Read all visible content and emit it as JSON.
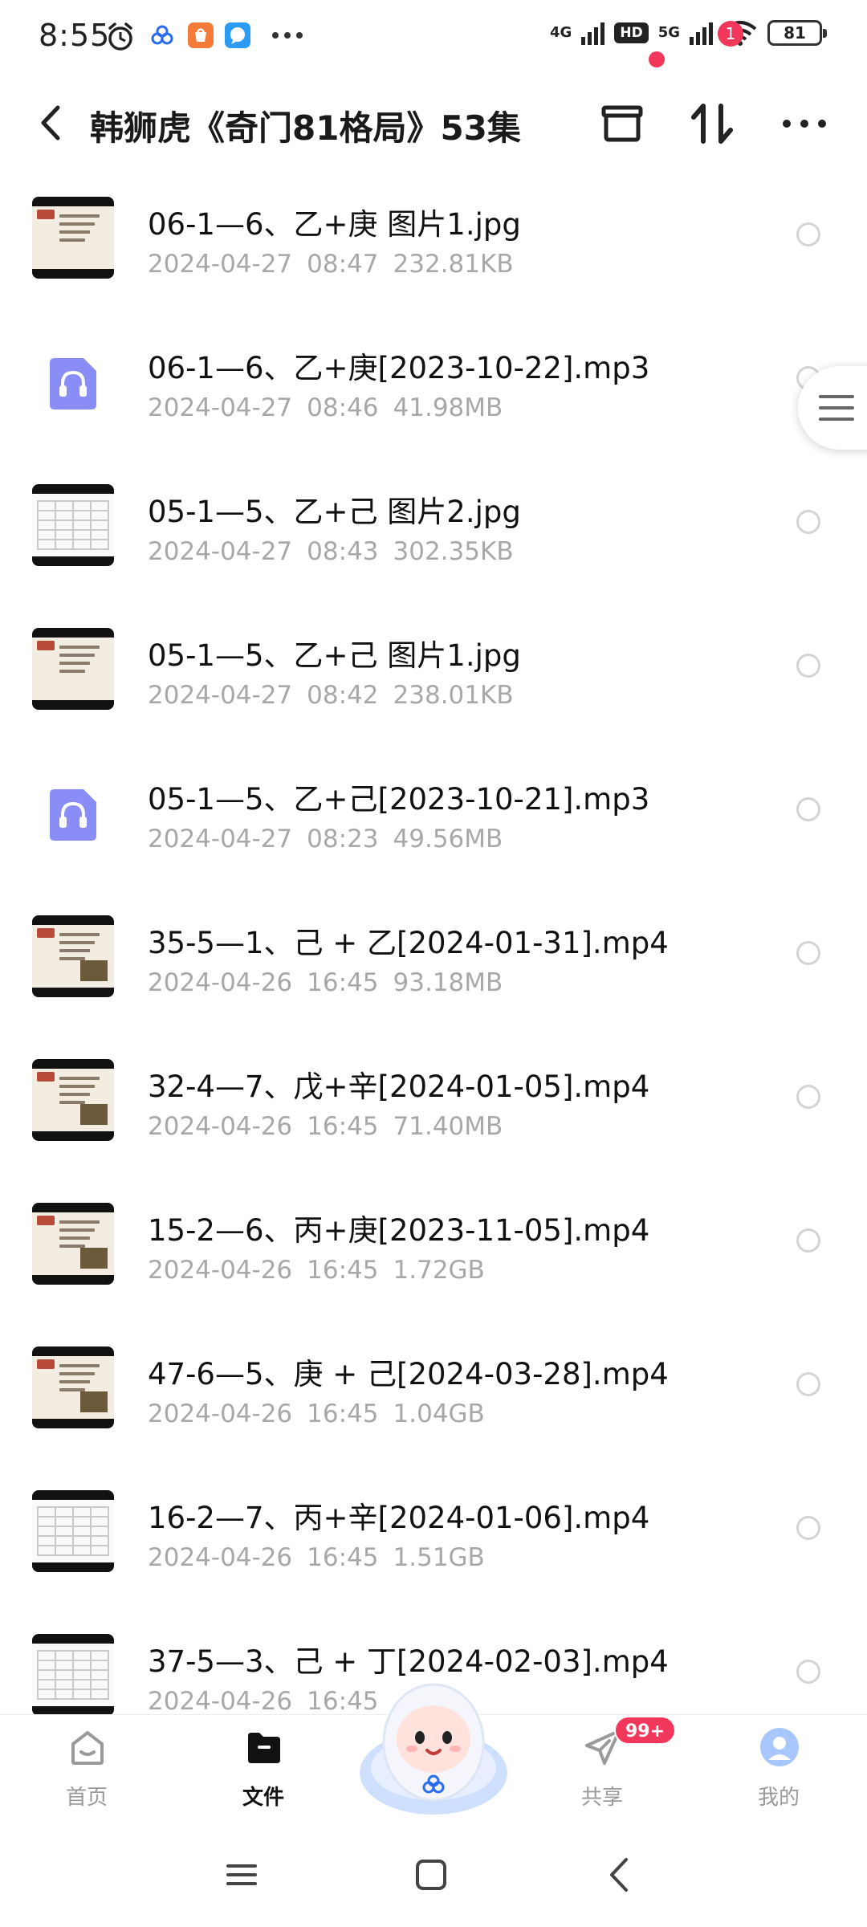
{
  "status_bar": {
    "time": "8:55",
    "network_1": "4G",
    "network_2": "5G",
    "hd": "HD",
    "battery": "81"
  },
  "header": {
    "title": "韩狮虎《奇门81格局》53集",
    "transfer_badge": "1"
  },
  "files": [
    {
      "name": "06-1—6、乙+庚 图片1.jpg",
      "date": "2024-04-27",
      "time": "08:47",
      "size": "232.81KB",
      "type": "image"
    },
    {
      "name": "06-1—6、乙+庚[2023-10-22].mp3",
      "date": "2024-04-27",
      "time": "08:46",
      "size": "41.98MB",
      "type": "audio"
    },
    {
      "name": "05-1—5、乙+己 图片2.jpg",
      "date": "2024-04-27",
      "time": "08:43",
      "size": "302.35KB",
      "type": "table"
    },
    {
      "name": "05-1—5、乙+己 图片1.jpg",
      "date": "2024-04-27",
      "time": "08:42",
      "size": "238.01KB",
      "type": "image"
    },
    {
      "name": "05-1—5、乙+己[2023-10-21].mp3",
      "date": "2024-04-27",
      "time": "08:23",
      "size": "49.56MB",
      "type": "audio"
    },
    {
      "name": "35-5—1、己 + 乙[2024-01-31].mp4",
      "date": "2024-04-26",
      "time": "16:45",
      "size": "93.18MB",
      "type": "video"
    },
    {
      "name": "32-4—7、戊+辛[2024-01-05].mp4",
      "date": "2024-04-26",
      "time": "16:45",
      "size": "71.40MB",
      "type": "video"
    },
    {
      "name": "15-2—6、丙+庚[2023-11-05].mp4",
      "date": "2024-04-26",
      "time": "16:45",
      "size": "1.72GB",
      "type": "video"
    },
    {
      "name": "47-6—5、庚 + 己[2024-03-28].mp4",
      "date": "2024-04-26",
      "time": "16:45",
      "size": "1.04GB",
      "type": "video"
    },
    {
      "name": "16-2—7、丙+辛[2024-01-06].mp4",
      "date": "2024-04-26",
      "time": "16:45",
      "size": "1.51GB",
      "type": "table"
    },
    {
      "name": "37-5—3、己 + 丁[2024-02-03].mp4",
      "date": "2024-04-26",
      "time": "16:45",
      "size": "",
      "type": "table"
    }
  ],
  "bottom_nav": {
    "home": "首页",
    "files": "文件",
    "share": "共享",
    "share_badge": "99+",
    "me": "我的"
  },
  "colors": {
    "accent_red": "#f2375a",
    "audio_purple": "#8a8df5",
    "meta_gray": "#a8a8a8"
  },
  "icons": [
    "back-icon",
    "archive-icon",
    "transfer-icon",
    "more-icon",
    "audio-file-icon",
    "menu-handle-icon",
    "home-icon",
    "folder-icon",
    "share-icon",
    "avatar-icon",
    "mascot-icon"
  ]
}
